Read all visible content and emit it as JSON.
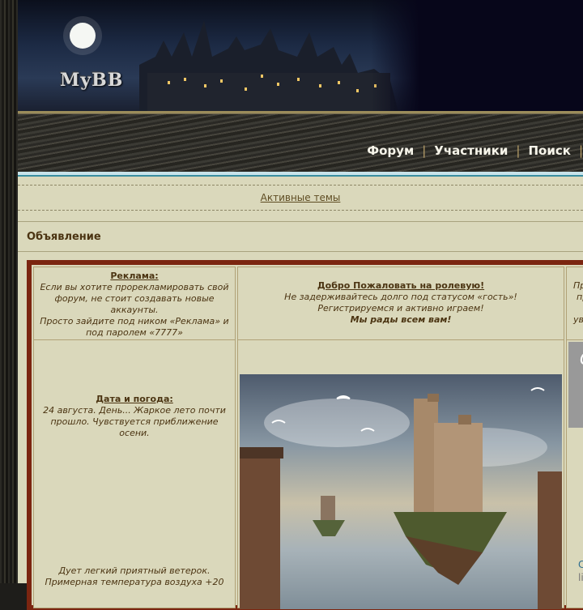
{
  "header": {
    "logo_text": "MyBB"
  },
  "nav": {
    "items": [
      "Форум",
      "Участники",
      "Поиск"
    ],
    "separator": "|"
  },
  "active_topics": "Активные темы",
  "announcement": {
    "heading": "Объявление",
    "ad": {
      "title": "Реклама:",
      "text": "Если вы хотите прорекламировать свой форум, не стоит создавать новые аккаунты.",
      "text2": "Просто зайдите под ником «Реклама» и под паролем «7777»"
    },
    "welcome": {
      "title": "Добро Пожаловать на ролевую!",
      "line1": "Не задерживайтесь долго под статусом «гость»!",
      "line2": "Регистрируемся и активно играем!",
      "line3": "Мы рады всем вам!"
    },
    "right_col": {
      "line1": "Пр",
      "line2": "пр",
      "line3": "ув"
    },
    "date_weather": {
      "title": "Дата и погода:",
      "text": "24 августа. День... Жаркое лето почти прошло. Чувствуется приближение осени.",
      "wind": "Дует легкий приятный ветерок. Примерная температура воздуха +20"
    },
    "side": {
      "letter": "С",
      "link": "С",
      "text": "li"
    }
  },
  "colors": {
    "frame": "#7b2510",
    "page": "#dad8bb",
    "accent_link": "#2e6d8e"
  },
  "icons": {
    "moon": "moon-icon",
    "castle": "castle-illustration"
  }
}
